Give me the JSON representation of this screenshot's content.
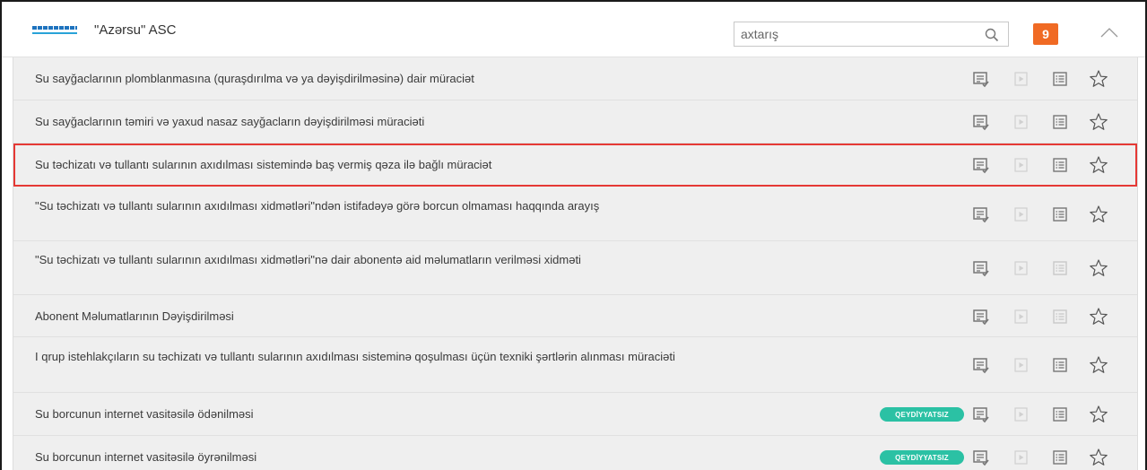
{
  "header": {
    "org_name": "\"Azərsu\" ASC",
    "search_placeholder": "axtarış",
    "count": "9"
  },
  "colors": {
    "badge": "#f06a24",
    "tag": "#2bc1a4",
    "highlight": "#e53935",
    "row_bg": "#efefef"
  },
  "services": [
    {
      "title": "Su sayğaclarının plomblanmasına (quraşdırılma və ya dəyişdirilməsinə) dair müraciət",
      "tag": "",
      "highlighted": false
    },
    {
      "title": "Su sayğaclarının təmiri və yaxud nasaz sayğacların dəyişdirilməsi müraciəti",
      "tag": "",
      "highlighted": false
    },
    {
      "title": "Su təchizatı və tullantı sularının axıdılması sistemində baş vermiş qəza ilə bağlı müraciət",
      "tag": "",
      "highlighted": true
    },
    {
      "title": "\"Su təchizatı və tullantı sularının axıdılması xidmətləri\"ndən istifadəyə görə borcun olmaması haqqında arayış",
      "tag": "",
      "highlighted": false
    },
    {
      "title": "\"Su təchizatı və tullantı sularının axıdılması xidmətləri\"nə dair abonentə aid məlumatların verilməsi xidməti",
      "tag": "",
      "highlighted": false
    },
    {
      "title": "Abonent Məlumatlarının Dəyişdirilməsi",
      "tag": "",
      "highlighted": false
    },
    {
      "title": "I qrup istehlakçıların su təchizatı və tullantı sularının axıdılması sisteminə qoşulması üçün texniki şərtlərin alınması müraciəti",
      "tag": "",
      "highlighted": false
    },
    {
      "title": "Su borcunun internet vasitəsilə ödənilməsi",
      "tag": "QEYDİYYATSIZ",
      "highlighted": false
    },
    {
      "title": "Su borcunun internet vasitəsilə öyrənilməsi",
      "tag": "QEYDİYYATSIZ",
      "highlighted": false
    }
  ],
  "row_icons": [
    "apply-icon",
    "play-icon",
    "list-icon",
    "star-icon"
  ]
}
